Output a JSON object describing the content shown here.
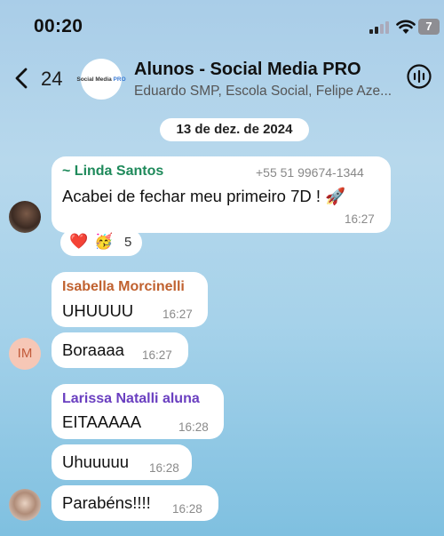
{
  "status_bar": {
    "time": "00:20",
    "battery": "7"
  },
  "header": {
    "back_count": "24",
    "avatar_logo_text": "Social Media",
    "avatar_logo_accent": "PRO",
    "title": "Alunos - Social Media PRO",
    "members": "Eduardo SMP, Escola Social, Felipe Aze..."
  },
  "date_separator": "13 de dez. de 2024",
  "messages": [
    {
      "sender": "~ Linda Santos",
      "sender_color": "#1f8a5b",
      "phone": "+55 51 99674-1344",
      "text": "Acabei de fechar meu primeiro 7D ! 🚀",
      "time": "16:27",
      "reactions": {
        "emoji_1": "❤️",
        "emoji_2": "🥳",
        "count": "5"
      }
    },
    {
      "sender": "Isabella Morcinelli",
      "sender_color": "#c0612f",
      "text": "UHUUUU",
      "time": "16:27"
    },
    {
      "text": "Boraaaa",
      "time": "16:27",
      "avatar_initials": "IM"
    },
    {
      "sender": "Larissa Natalli aluna",
      "sender_color": "#6a3fc0",
      "text": "EITAAAAA",
      "time": "16:28"
    },
    {
      "text": "Uhuuuuu",
      "time": "16:28"
    },
    {
      "text": "Parabéns!!!!",
      "time": "16:28"
    }
  ],
  "colors": {
    "background_top": "#a9cde8",
    "background_bottom": "#7fc0e0",
    "bubble": "#ffffff"
  }
}
